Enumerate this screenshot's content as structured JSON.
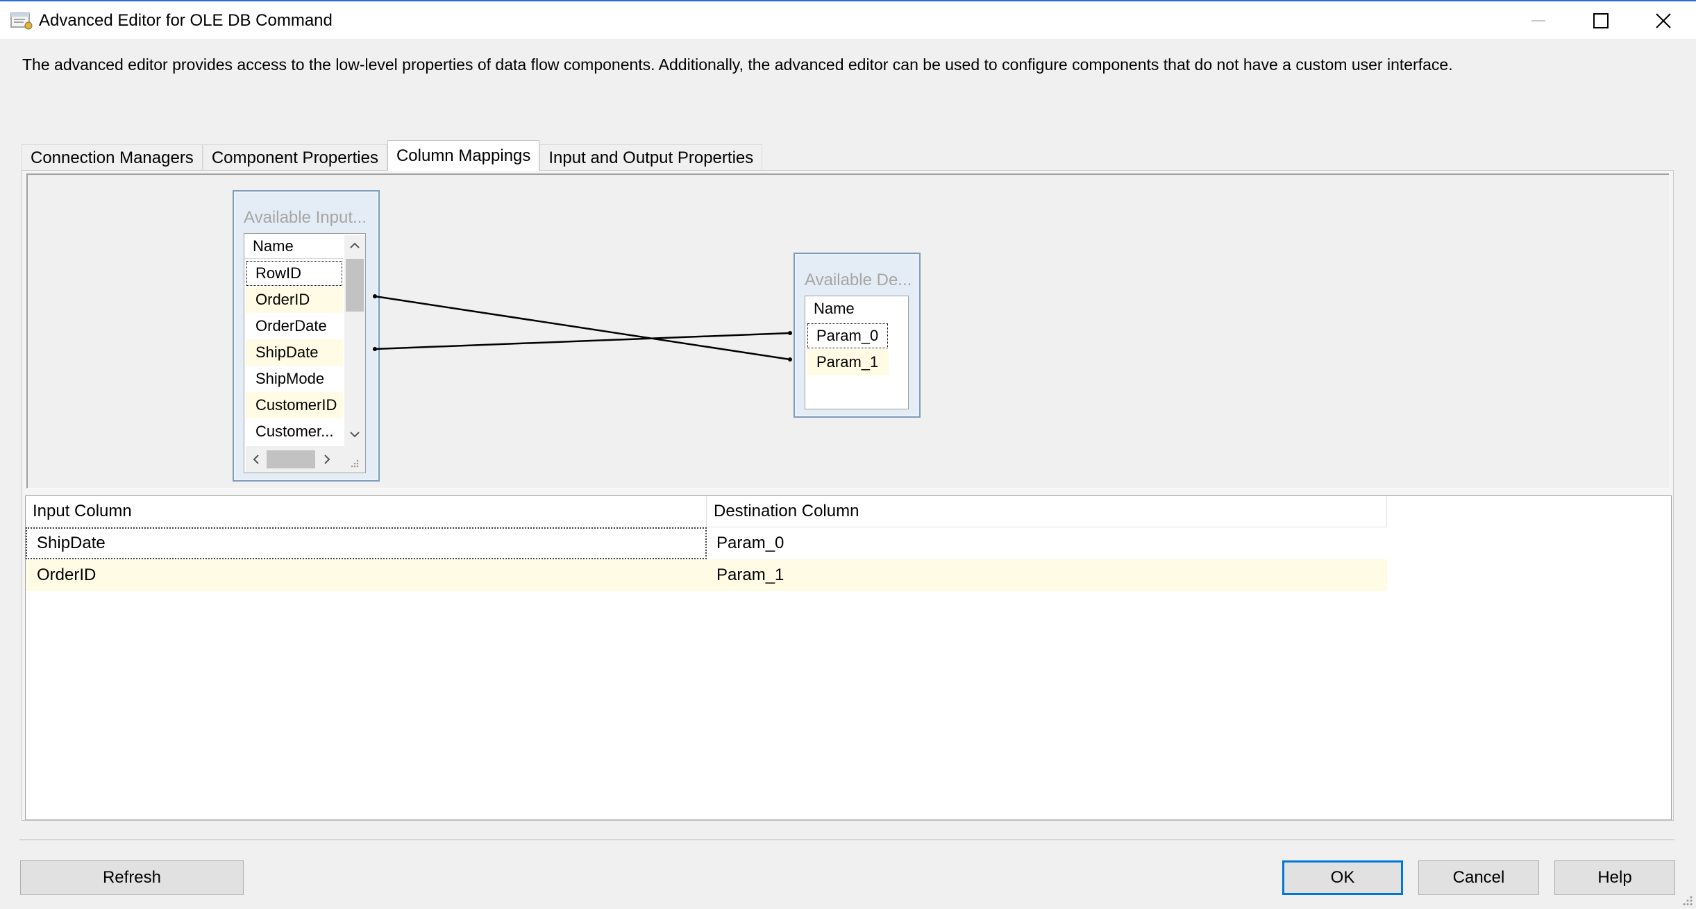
{
  "window": {
    "title": "Advanced Editor for OLE DB Command",
    "minimize_icon": "minimize-icon",
    "maximize_icon": "maximize-icon",
    "close_icon": "close-icon"
  },
  "description": "The advanced editor provides access to the low-level properties of data flow components. Additionally, the advanced editor can be used to configure components that do not have a custom user interface.",
  "tabs": [
    {
      "label": "Connection Managers",
      "active": false
    },
    {
      "label": "Component Properties",
      "active": false
    },
    {
      "label": "Column Mappings",
      "active": true
    },
    {
      "label": "Input and Output Properties",
      "active": false
    }
  ],
  "available_inputs": {
    "title": "Available Input...",
    "header": "Name",
    "rows": [
      "RowID",
      "OrderID",
      "OrderDate",
      "ShipDate",
      "ShipMode",
      "CustomerID",
      "Customer..."
    ]
  },
  "available_destinations": {
    "title": "Available De...",
    "header": "Name",
    "rows": [
      "Param_0",
      "Param_1"
    ]
  },
  "mappings_grid": {
    "headers": [
      "Input Column",
      "Destination Column"
    ],
    "rows": [
      {
        "input": "ShipDate",
        "destination": "Param_0"
      },
      {
        "input": "OrderID",
        "destination": "Param_1"
      }
    ]
  },
  "buttons": {
    "refresh": "Refresh",
    "ok": "OK",
    "cancel": "Cancel",
    "help": "Help"
  },
  "colors": {
    "accent": "#0078d7",
    "alt_row": "#fffbe5",
    "box_border": "#7f9db9"
  }
}
